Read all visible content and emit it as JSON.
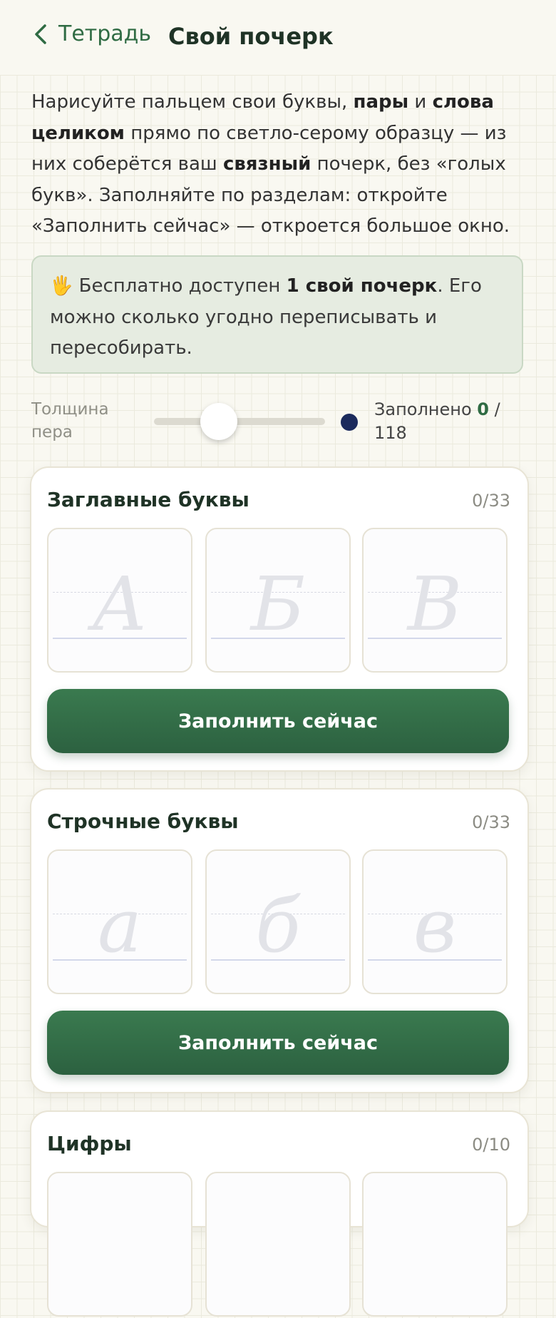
{
  "header": {
    "back_label": "Тетрадь",
    "title": "Свой почерк"
  },
  "intro": {
    "p1": "Нарисуйте пальцем свои буквы, ",
    "b1": "пары",
    "p2": " и ",
    "b2": "слова целиком",
    "p3": " прямо по светло-серому образцу — из них соберётся ваш ",
    "b3": "связный",
    "p4": " почерк, без «голых букв». Заполняйте по разделам: откройте «Заполнить сейчас» — откроется большое окно."
  },
  "notice": {
    "emoji": "🖐",
    "p1": " Бесплатно доступен ",
    "b1": "1 свой почерк",
    "p2": ". Его можно сколько угодно переписывать и пересобирать."
  },
  "pen": {
    "label": "Толщина пера",
    "level": 0.38,
    "ink_color": "#1b2a5c"
  },
  "progress": {
    "prefix": "Заполнено ",
    "filled": "0",
    "suffix": " / 118"
  },
  "sections": [
    {
      "title": "Заглавные буквы",
      "count": "0/33",
      "samples": [
        "А",
        "Б",
        "В"
      ],
      "button": "Заполнить сейчас"
    },
    {
      "title": "Строчные буквы",
      "count": "0/33",
      "samples": [
        "а",
        "б",
        "в"
      ],
      "button": "Заполнить сейчас"
    },
    {
      "title": "Цифры",
      "count": "0/10"
    }
  ],
  "colors": {
    "accent": "#2f6b43",
    "notice_bg": "#e6ece1"
  }
}
